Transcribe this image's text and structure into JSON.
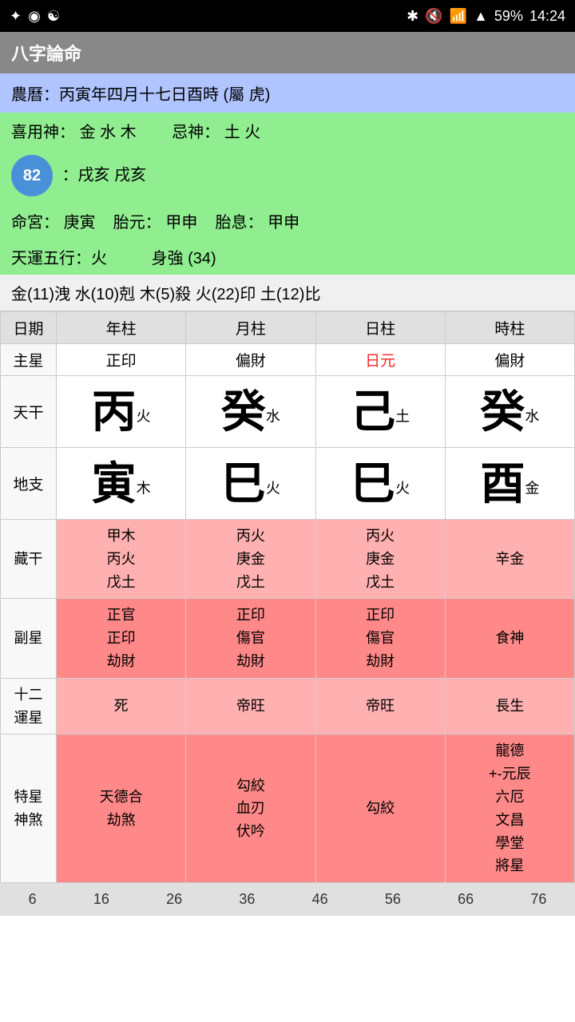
{
  "statusBar": {
    "time": "14:24",
    "battery": "59%",
    "icons": [
      "bluetooth",
      "mute",
      "wifi",
      "signal"
    ]
  },
  "titleBar": {
    "title": "八字論命"
  },
  "infoBar": {
    "text": "農曆：丙寅年四月十七日酉時 (屬 虎)"
  },
  "xiyong": {
    "label": "喜用神：",
    "value": "金 水 木",
    "jishen_label": "忌神：",
    "jishen_value": "土 火"
  },
  "kongwang": {
    "badge": "82",
    "text": "：戌亥 戌亥"
  },
  "minggong": {
    "label1": "命宮：",
    "val1": "庚寅",
    "label2": "胎元：",
    "val2": "甲申",
    "label3": "胎息：",
    "val3": "甲申"
  },
  "tianyun": {
    "wuxing": "天運五行：火",
    "shengqiang": "身強 (34)"
  },
  "wuxingBar": {
    "text": "金(11)洩  水(10)剋  木(5)殺  火(22)印  土(12)比"
  },
  "tableHeaders": [
    "日期",
    "年柱",
    "月柱",
    "日柱",
    "時柱"
  ],
  "zhuxing": {
    "label": "主星",
    "cols": [
      "正印",
      "偏財",
      "日元",
      "偏財"
    ],
    "redCol": 2
  },
  "tiangan": {
    "label": "天干",
    "cols": [
      {
        "big": "丙",
        "small": "火"
      },
      {
        "big": "癸",
        "small": "水"
      },
      {
        "big": "己",
        "small": "土"
      },
      {
        "big": "癸",
        "small": "水"
      }
    ]
  },
  "dizhi": {
    "label": "地支",
    "cols": [
      {
        "big": "寅",
        "small": "木"
      },
      {
        "big": "巳",
        "small": "火"
      },
      {
        "big": "巳",
        "small": "火"
      },
      {
        "big": "酉",
        "small": "金"
      }
    ]
  },
  "zanggan": {
    "label": "藏干",
    "cols": [
      [
        "甲木",
        "丙火",
        "戊土"
      ],
      [
        "丙火",
        "庚金",
        "戊土"
      ],
      [
        "丙火",
        "庚金",
        "戊土"
      ],
      [
        "辛金"
      ]
    ]
  },
  "fuxing": {
    "label": "副星",
    "cols": [
      [
        "正官",
        "正印",
        "劫財"
      ],
      [
        "正印",
        "傷官",
        "劫財"
      ],
      [
        "正印",
        "傷官",
        "劫財"
      ],
      [
        "食神"
      ]
    ]
  },
  "yunxing": {
    "label1": "十二",
    "label2": "運星",
    "cols": [
      "死",
      "帝旺",
      "帝旺",
      "長生"
    ]
  },
  "texing": {
    "label1": "特星",
    "label2": "神煞",
    "cols": [
      [
        "天德合",
        "劫煞"
      ],
      [
        "勾絞",
        "血刃",
        "伏吟"
      ],
      [
        "勾絞"
      ],
      [
        "龍德",
        "+-元辰",
        "六厄",
        "文昌",
        "學堂",
        "將星"
      ]
    ]
  },
  "bottomNumbers": [
    "6",
    "16",
    "26",
    "36",
    "46",
    "56",
    "66",
    "76"
  ]
}
